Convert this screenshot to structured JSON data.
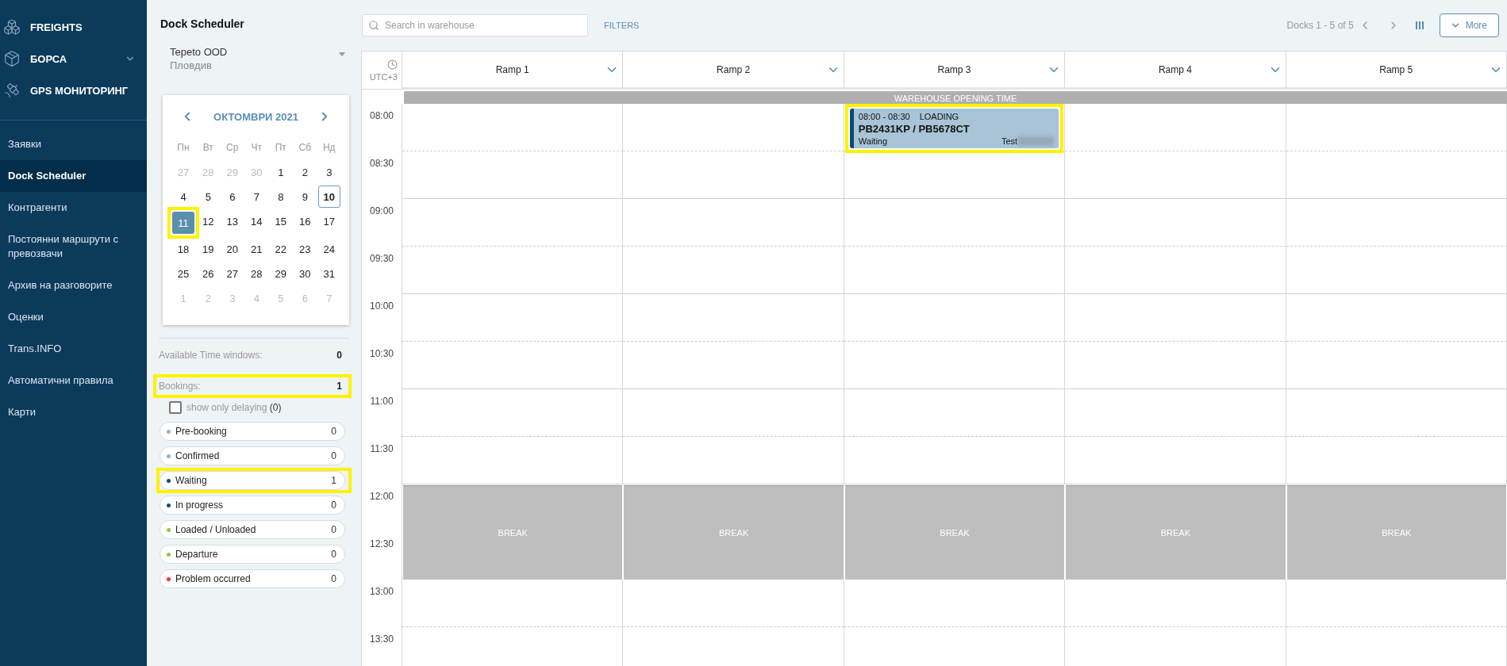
{
  "sidebar": {
    "top_items": [
      {
        "label": "FREIGHTS",
        "expandable": false
      },
      {
        "label": "БОРСА",
        "expandable": true
      },
      {
        "label": "GPS МОНИТОРИНГ",
        "expandable": false
      }
    ],
    "items": [
      {
        "label": "Заявки",
        "selected": false
      },
      {
        "label": "Dock Scheduler",
        "selected": true
      },
      {
        "label": "Контрагенти",
        "selected": false
      },
      {
        "label": "Постоянни маршрути с превозвачи",
        "selected": false
      },
      {
        "label": "Архив на разговорите",
        "selected": false
      },
      {
        "label": "Оценки",
        "selected": false
      },
      {
        "label": "Trans.INFO",
        "selected": false
      },
      {
        "label": "Автоматични правила",
        "selected": false
      },
      {
        "label": "Карти",
        "selected": false
      }
    ]
  },
  "panel": {
    "title": "Dock Scheduler",
    "warehouse": {
      "name": "Tepeto OOD",
      "city": "Пловдив"
    },
    "calendar": {
      "month": "ОКТОМВРИ 2021",
      "weekdays": [
        "Пн",
        "Вт",
        "Ср",
        "Чт",
        "Пт",
        "Сб",
        "Нд"
      ],
      "weeks": [
        [
          {
            "label": "27",
            "muted": true,
            "selected": false,
            "today": false,
            "highlighted": false
          },
          {
            "label": "28",
            "muted": true,
            "selected": false,
            "today": false,
            "highlighted": false
          },
          {
            "label": "29",
            "muted": true,
            "selected": false,
            "today": false,
            "highlighted": false
          },
          {
            "label": "30",
            "muted": true,
            "selected": false,
            "today": false,
            "highlighted": false
          },
          {
            "label": "1",
            "muted": false,
            "selected": false,
            "today": false,
            "highlighted": false
          },
          {
            "label": "2",
            "muted": false,
            "selected": false,
            "today": false,
            "highlighted": false
          },
          {
            "label": "3",
            "muted": false,
            "selected": false,
            "today": false,
            "highlighted": false
          }
        ],
        [
          {
            "label": "4",
            "muted": false,
            "selected": false,
            "today": false,
            "highlighted": false
          },
          {
            "label": "5",
            "muted": false,
            "selected": false,
            "today": false,
            "highlighted": false
          },
          {
            "label": "6",
            "muted": false,
            "selected": false,
            "today": false,
            "highlighted": false
          },
          {
            "label": "7",
            "muted": false,
            "selected": false,
            "today": false,
            "highlighted": false
          },
          {
            "label": "8",
            "muted": false,
            "selected": false,
            "today": false,
            "highlighted": false
          },
          {
            "label": "9",
            "muted": false,
            "selected": false,
            "today": false,
            "highlighted": false
          },
          {
            "label": "10",
            "muted": false,
            "selected": false,
            "today": true,
            "highlighted": false
          }
        ],
        [
          {
            "label": "11",
            "muted": false,
            "selected": true,
            "today": false,
            "highlighted": true
          },
          {
            "label": "12",
            "muted": false,
            "selected": false,
            "today": false,
            "highlighted": false
          },
          {
            "label": "13",
            "muted": false,
            "selected": false,
            "today": false,
            "highlighted": false
          },
          {
            "label": "14",
            "muted": false,
            "selected": false,
            "today": false,
            "highlighted": false
          },
          {
            "label": "15",
            "muted": false,
            "selected": false,
            "today": false,
            "highlighted": false
          },
          {
            "label": "16",
            "muted": false,
            "selected": false,
            "today": false,
            "highlighted": false
          },
          {
            "label": "17",
            "muted": false,
            "selected": false,
            "today": false,
            "highlighted": false
          }
        ],
        [
          {
            "label": "18",
            "muted": false,
            "selected": false,
            "today": false,
            "highlighted": false
          },
          {
            "label": "19",
            "muted": false,
            "selected": false,
            "today": false,
            "highlighted": false
          },
          {
            "label": "20",
            "muted": false,
            "selected": false,
            "today": false,
            "highlighted": false
          },
          {
            "label": "21",
            "muted": false,
            "selected": false,
            "today": false,
            "highlighted": false
          },
          {
            "label": "22",
            "muted": false,
            "selected": false,
            "today": false,
            "highlighted": false
          },
          {
            "label": "23",
            "muted": false,
            "selected": false,
            "today": false,
            "highlighted": false
          },
          {
            "label": "24",
            "muted": false,
            "selected": false,
            "today": false,
            "highlighted": false
          }
        ],
        [
          {
            "label": "25",
            "muted": false,
            "selected": false,
            "today": false,
            "highlighted": false
          },
          {
            "label": "26",
            "muted": false,
            "selected": false,
            "today": false,
            "highlighted": false
          },
          {
            "label": "27",
            "muted": false,
            "selected": false,
            "today": false,
            "highlighted": false
          },
          {
            "label": "28",
            "muted": false,
            "selected": false,
            "today": false,
            "highlighted": false
          },
          {
            "label": "29",
            "muted": false,
            "selected": false,
            "today": false,
            "highlighted": false
          },
          {
            "label": "30",
            "muted": false,
            "selected": false,
            "today": false,
            "highlighted": false
          },
          {
            "label": "31",
            "muted": false,
            "selected": false,
            "today": false,
            "highlighted": false
          }
        ],
        [
          {
            "label": "1",
            "muted": true,
            "selected": false,
            "today": false,
            "highlighted": false
          },
          {
            "label": "2",
            "muted": true,
            "selected": false,
            "today": false,
            "highlighted": false
          },
          {
            "label": "3",
            "muted": true,
            "selected": false,
            "today": false,
            "highlighted": false
          },
          {
            "label": "4",
            "muted": true,
            "selected": false,
            "today": false,
            "highlighted": false
          },
          {
            "label": "5",
            "muted": true,
            "selected": false,
            "today": false,
            "highlighted": false
          },
          {
            "label": "6",
            "muted": true,
            "selected": false,
            "today": false,
            "highlighted": false
          },
          {
            "label": "7",
            "muted": true,
            "selected": false,
            "today": false,
            "highlighted": false
          }
        ]
      ]
    },
    "stats": [
      {
        "label": "Available Time windows:",
        "value": "0",
        "highlighted": false
      },
      {
        "label": "Bookings:",
        "value": "1",
        "highlighted": true
      }
    ],
    "delaying": {
      "label": "show only delaying",
      "count": "(0)",
      "checked": false
    },
    "statuses": [
      {
        "label": "Pre-booking",
        "count": "0",
        "color": "#8fb4cc",
        "highlighted": false
      },
      {
        "label": "Confirmed",
        "count": "0",
        "color": "#8fb4cc",
        "highlighted": false
      },
      {
        "label": "Waiting",
        "count": "1",
        "color": "#0d4a78",
        "highlighted": true
      },
      {
        "label": "In progress",
        "count": "0",
        "color": "#0d4a78",
        "highlighted": false
      },
      {
        "label": "Loaded / Unloaded",
        "count": "0",
        "color": "#8dc63f",
        "highlighted": false
      },
      {
        "label": "Departure",
        "count": "0",
        "color": "#8dc63f",
        "highlighted": false
      },
      {
        "label": "Problem occurred",
        "count": "0",
        "color": "#ff2a2a",
        "highlighted": false
      }
    ]
  },
  "toolbar": {
    "search": {
      "placeholder": "Search in warehouse"
    },
    "filters": "FILTERS",
    "pager": "Docks 1 - 5 of 5",
    "more": "More"
  },
  "schedule": {
    "timezone": "UTC+3",
    "opening": "WAREHOUSE OPENING TIME",
    "ramps": [
      {
        "name": "Ramp 1",
        "break_label": "BREAK"
      },
      {
        "name": "Ramp 2",
        "break_label": "BREAK"
      },
      {
        "name": "Ramp 3",
        "break_label": "BREAK"
      },
      {
        "name": "Ramp 4",
        "break_label": "BREAK"
      },
      {
        "name": "Ramp 5",
        "break_label": "BREAK"
      }
    ],
    "rows": [
      {
        "time": "08:00",
        "kind": "open",
        "cells": [
          {
            "kind": "empty"
          },
          {
            "kind": "empty"
          },
          {
            "kind": "booking",
            "window": "08:00 - 08:30",
            "type": "LOADING",
            "plates": "PB2431KP / PB5678CT",
            "status": "Waiting",
            "client": "Test",
            "color": "#0d4a78",
            "redacted": true,
            "highlighted": true
          },
          {
            "kind": "empty"
          },
          {
            "kind": "empty"
          }
        ]
      },
      {
        "time": "08:30",
        "kind": "open"
      },
      {
        "time": "09:00",
        "kind": "open"
      },
      {
        "time": "09:30",
        "kind": "open"
      },
      {
        "time": "10:00",
        "kind": "open"
      },
      {
        "time": "10:30",
        "kind": "open"
      },
      {
        "time": "11:00",
        "kind": "open"
      },
      {
        "time": "11:30",
        "kind": "open"
      },
      {
        "time": "12:00",
        "kind": "break"
      },
      {
        "time": "12:30",
        "kind": "break"
      },
      {
        "time": "13:00",
        "kind": "open"
      },
      {
        "time": "13:30",
        "kind": "open"
      }
    ]
  }
}
